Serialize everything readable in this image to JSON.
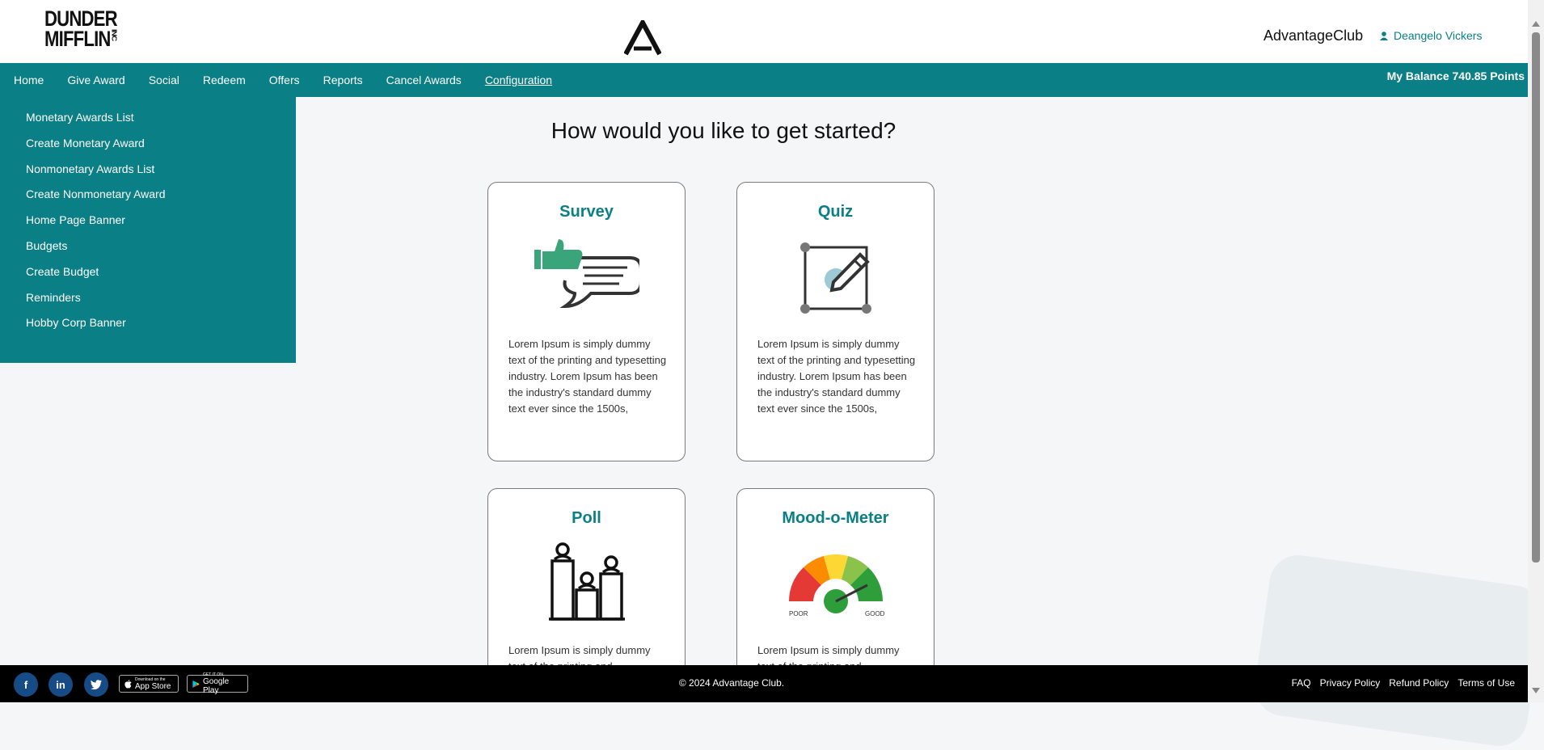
{
  "header": {
    "logo_line1": "DUNDER",
    "logo_line2": "MIFFLIN",
    "logo_suffix": "INC",
    "brand": "AdvantageClub",
    "user_name": "Deangelo Vickers"
  },
  "nav": {
    "items": [
      {
        "label": "Home"
      },
      {
        "label": "Give Award"
      },
      {
        "label": "Social"
      },
      {
        "label": "Redeem"
      },
      {
        "label": "Offers"
      },
      {
        "label": "Reports"
      },
      {
        "label": "Cancel Awards"
      },
      {
        "label": "Configuration"
      }
    ],
    "active": "Configuration",
    "balance": "My Balance 740.85 Points"
  },
  "sidebar": {
    "items": [
      {
        "label": "Monetary Awards List"
      },
      {
        "label": "Create Monetary Award"
      },
      {
        "label": "Nonmonetary Awards List"
      },
      {
        "label": "Create Nonmonetary Award"
      },
      {
        "label": "Home Page Banner"
      },
      {
        "label": "Budgets"
      },
      {
        "label": "Create Budget"
      },
      {
        "label": "Reminders"
      },
      {
        "label": "Hobby Corp Banner"
      }
    ]
  },
  "main": {
    "heading": "How would you like to get started?",
    "cards": [
      {
        "title": "Survey",
        "icon": "survey-thumbs-up-chat-icon",
        "description": "Lorem Ipsum is simply dummy text of the printing and typesetting industry. Lorem Ipsum has been the industry's standard dummy text ever since the 1500s,"
      },
      {
        "title": "Quiz",
        "icon": "quiz-pencil-frame-icon",
        "description": "Lorem Ipsum is simply dummy text of the printing and typesetting industry. Lorem Ipsum has been the industry's standard dummy text ever since the 1500s,"
      },
      {
        "title": "Poll",
        "icon": "poll-bars-icon",
        "description": "Lorem Ipsum is simply dummy text of the printing and"
      },
      {
        "title": "Mood-o-Meter",
        "icon": "mood-meter-gauge-icon",
        "description": "Lorem Ipsum is simply dummy text of the printing and",
        "gauge_left": "POOR",
        "gauge_right": "GOOD"
      }
    ]
  },
  "footer": {
    "social": [
      {
        "label": "f",
        "icon": "facebook-icon"
      },
      {
        "label": "in",
        "icon": "linkedin-icon"
      },
      {
        "label": "twitter-icon",
        "icon": "twitter-icon"
      }
    ],
    "app_store": {
      "small": "Download on the",
      "big": "App Store"
    },
    "google_play": {
      "small": "GET IT ON",
      "big": "Google Play"
    },
    "copyright": "© 2024 Advantage Club.",
    "links": [
      {
        "label": "FAQ"
      },
      {
        "label": "Privacy Policy"
      },
      {
        "label": "Refund Policy"
      },
      {
        "label": "Terms of Use"
      }
    ]
  },
  "colors": {
    "accent": "#0a7f86",
    "nav_bg": "#0a7f86",
    "footer_bg": "#000000",
    "page_bg": "#f4f6f8"
  }
}
